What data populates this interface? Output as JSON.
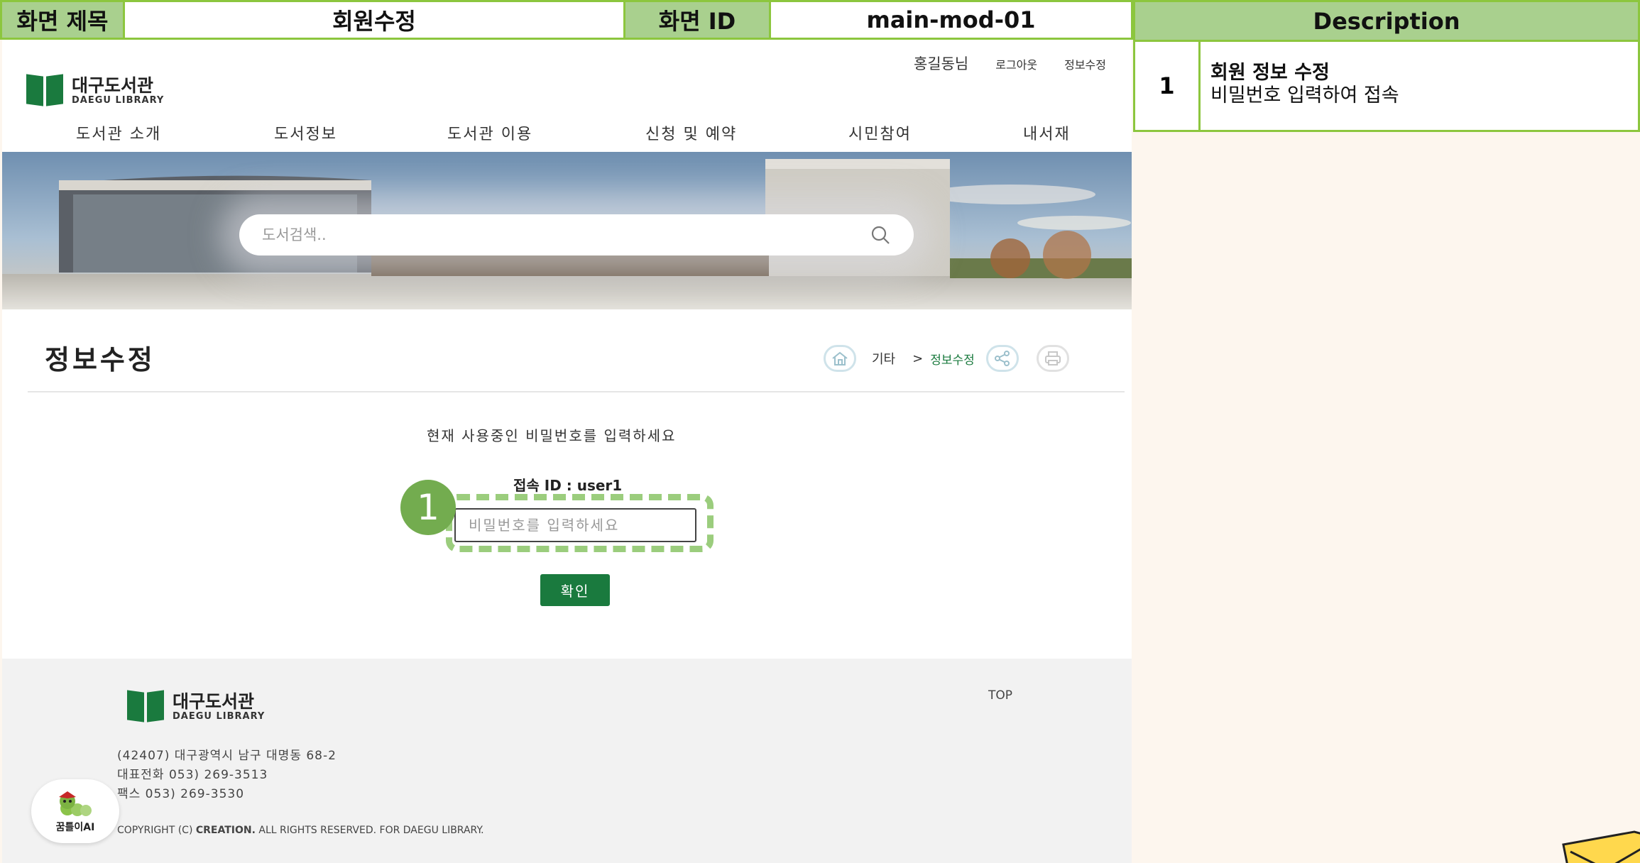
{
  "spec": {
    "title_label": "화면 제목",
    "title_value": "회원수정",
    "id_label": "화면 ID",
    "id_value": "main-mod-01",
    "description_header": "Description"
  },
  "description": {
    "number": "1",
    "title": "회원 정보 수정",
    "body": "비밀번호 입력하여 접속"
  },
  "header": {
    "logo_ko": "대구도서관",
    "logo_en": "DAEGU LIBRARY",
    "user_name": "홍길동님",
    "logout": "로그아웃",
    "edit_info": "정보수정"
  },
  "nav": [
    "도서관 소개",
    "도서정보",
    "도서관 이용",
    "신청 및 예약",
    "시민참여",
    "내서재"
  ],
  "search": {
    "placeholder": "도서검색.."
  },
  "page": {
    "title": "정보수정",
    "crumb_1": "기타",
    "crumb_sep": ">",
    "crumb_2": "정보수정",
    "prompt": "현재 사용중인 비밀번호를 입력하세요",
    "id_label": "접속 ID : user1",
    "password_placeholder": "비밀번호를 입력하세요",
    "confirm": "확인",
    "marker": "1"
  },
  "footer": {
    "logo_ko": "대구도서관",
    "logo_en": "DAEGU LIBRARY",
    "address": "(42407) 대구광역시 남구 대명동 68-2",
    "phone": "대표전화 053) 269-3513",
    "fax": "팩스 053) 269-3530",
    "top": "TOP",
    "copyright_pre": "COPYRIGHT (C)",
    "copyright_brand": "CREATION.",
    "copyright_post": "ALL RIGHTS RESERVED. FOR DAEGU LIBRARY.",
    "badge": "꿈틀이AI"
  },
  "colors": {
    "brand_green": "#1a7a3e",
    "spec_green": "#8cc63e",
    "spec_fill": "#a9d08e",
    "marker_green": "#73ac4f"
  }
}
